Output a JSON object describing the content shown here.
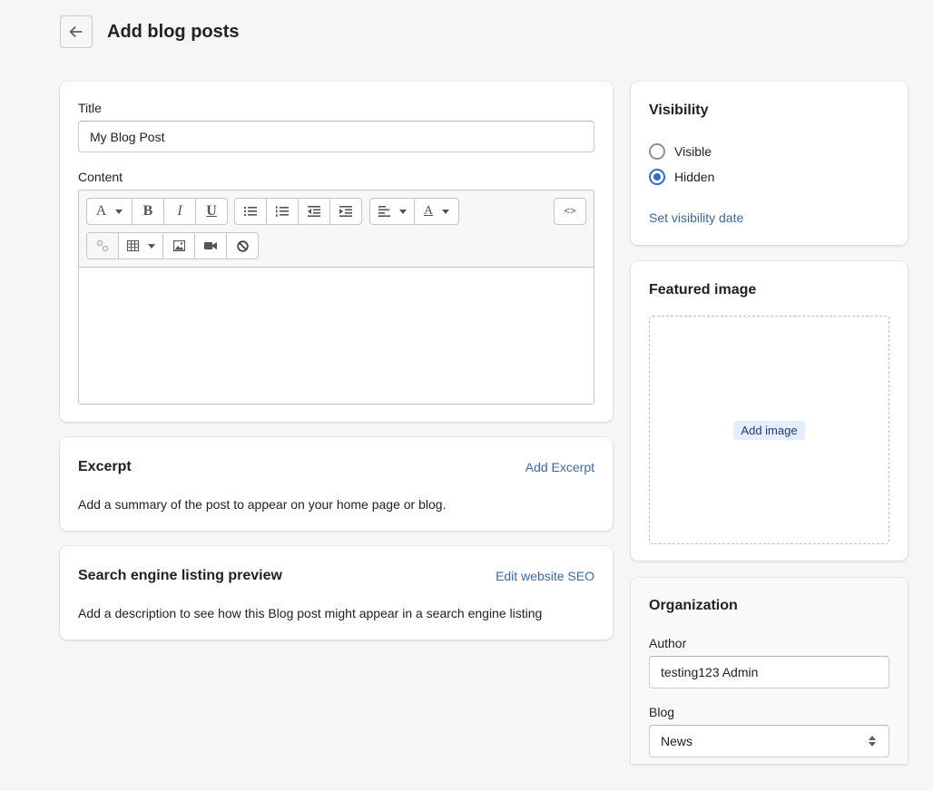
{
  "header": {
    "back_label": "Back",
    "title": "Add blog posts"
  },
  "main": {
    "title_label": "Title",
    "title_value": "My Blog Post",
    "content_label": "Content",
    "editor": {
      "toolbar_row1": [
        {
          "name": "font-format",
          "glyph": "A",
          "dropdown": true
        },
        {
          "name": "bold",
          "glyph": "B"
        },
        {
          "name": "italic",
          "glyph": "I"
        },
        {
          "name": "underline",
          "glyph": "U"
        },
        {
          "name": "bullet-list"
        },
        {
          "name": "numbered-list"
        },
        {
          "name": "outdent"
        },
        {
          "name": "indent"
        },
        {
          "name": "align",
          "dropdown": true
        },
        {
          "name": "text-color",
          "glyph": "A",
          "dropdown": true
        }
      ],
      "html_toggle_glyph": "<>",
      "toolbar_row2": [
        {
          "name": "link",
          "disabled": true
        },
        {
          "name": "table",
          "dropdown": true
        },
        {
          "name": "image"
        },
        {
          "name": "video"
        },
        {
          "name": "clear-formatting"
        }
      ],
      "body_text": ""
    }
  },
  "excerpt": {
    "heading": "Excerpt",
    "action": "Add Excerpt",
    "description": "Add a summary of the post to appear on your home page or blog."
  },
  "seo": {
    "heading": "Search engine listing preview",
    "action": "Edit website SEO",
    "description": "Add a description to see how this Blog post might appear in a search engine listing"
  },
  "visibility": {
    "heading": "Visibility",
    "options": [
      {
        "label": "Visible",
        "checked": false
      },
      {
        "label": "Hidden",
        "checked": true
      }
    ],
    "set_date_link": "Set visibility date"
  },
  "featured_image": {
    "heading": "Featured image",
    "add_button": "Add image"
  },
  "organization": {
    "heading": "Organization",
    "author_label": "Author",
    "author_value": "testing123 Admin",
    "blog_label": "Blog",
    "blog_value": "News"
  },
  "colors": {
    "accent": "#2c6ecb",
    "link": "#3a67a8",
    "page_bg": "#f6f6f7"
  }
}
